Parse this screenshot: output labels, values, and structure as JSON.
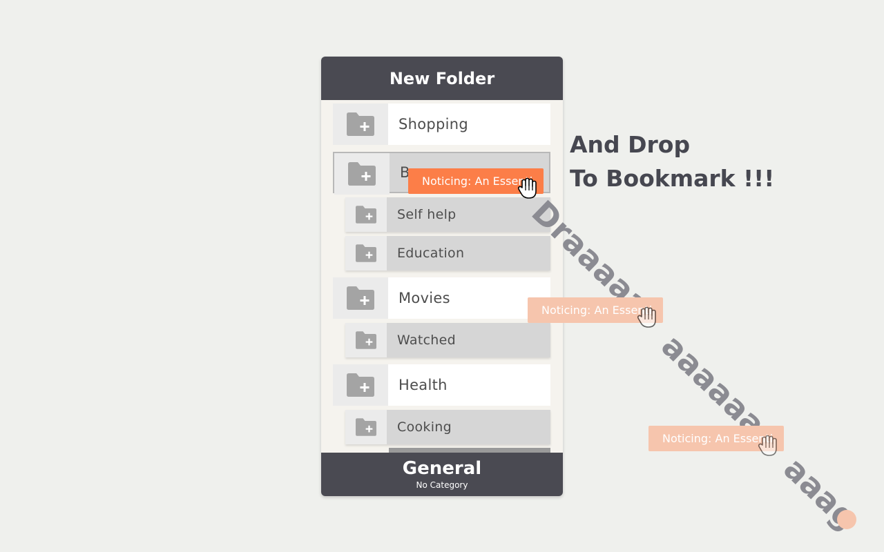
{
  "panel": {
    "title": "New Folder",
    "folders": [
      {
        "label": "Shopping",
        "level": "top"
      },
      {
        "label": "Books",
        "visible_label": "B",
        "level": "top",
        "state": "dragging"
      },
      {
        "label": "Self help",
        "level": "sub"
      },
      {
        "label": "Education",
        "level": "sub"
      },
      {
        "label": "Movies",
        "level": "top"
      },
      {
        "label": "Watched",
        "level": "sub"
      },
      {
        "label": "Health",
        "level": "top"
      },
      {
        "label": "Cooking",
        "level": "sub"
      }
    ],
    "footer": {
      "title": "General",
      "subtitle": "No Category"
    }
  },
  "heading": {
    "line1": "And Drop",
    "line2": "To Bookmark !!!"
  },
  "drag_text": {
    "part1": "Draaaaa",
    "part2": "aaaaaaa",
    "part3": "aaag"
  },
  "drag_tags": [
    {
      "text": "Noticing: An Essenti",
      "state": "active"
    },
    {
      "text": "Noticing: An Essenti",
      "state": "ghost"
    },
    {
      "text": "Noticing: An Essenti",
      "state": "ghost"
    }
  ],
  "icons": {
    "folder": "folder-plus-icon",
    "cursor": "grab-hand-cursor-icon"
  },
  "colors": {
    "header_bg": "#4a4a52",
    "accent_orange": "#fc7e48",
    "ghost_orange": "#f6c5ad",
    "panel_bg": "#f5f3ee",
    "sub_row_bg": "#d6d6d6"
  }
}
